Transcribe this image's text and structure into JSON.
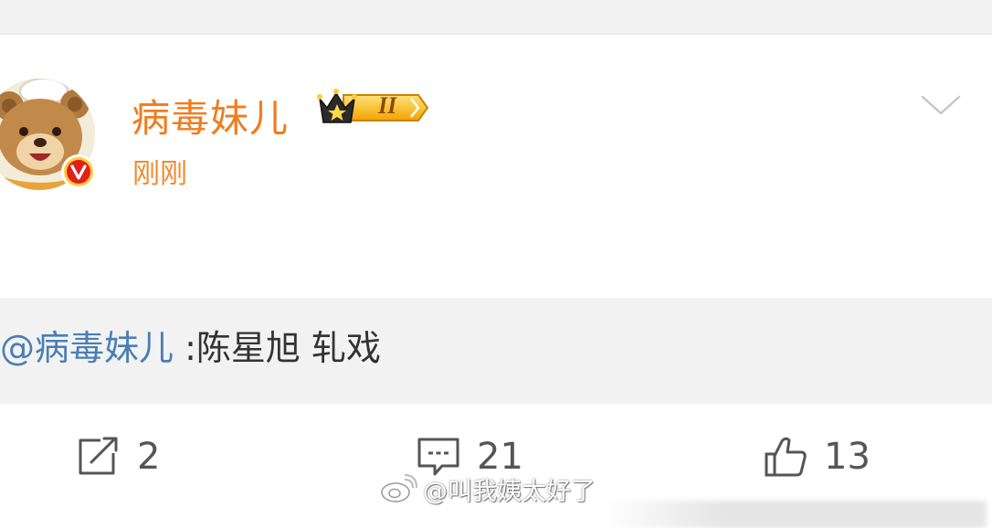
{
  "post": {
    "username": "病毒妹儿",
    "level_badge": "II",
    "timestamp": "刚刚",
    "repost": {
      "mention": "@病毒妹儿",
      "text": " :陈星旭 轧戏"
    }
  },
  "actions": {
    "repost_count": "2",
    "comment_count": "21",
    "like_count": "13"
  },
  "watermark": {
    "text": "@叫我姨太好了"
  },
  "colors": {
    "username": "#f07c1d",
    "timestamp": "#f08a2f",
    "mention": "#4a7eb6",
    "verified_badge": "#e0201b",
    "repost_bg": "#f2f2f2"
  },
  "icons": [
    "avatar-bear",
    "verified-v-icon",
    "crown-level-icon",
    "chevron-down-icon",
    "repost-icon",
    "comment-icon",
    "like-icon",
    "weibo-logo-icon"
  ]
}
